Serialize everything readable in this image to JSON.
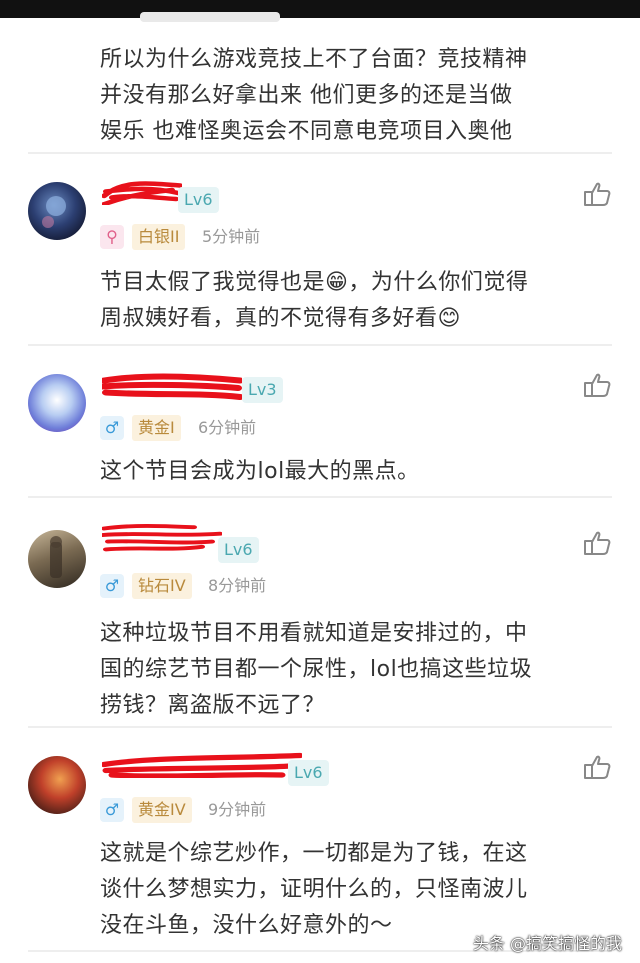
{
  "comments": [
    {
      "text_lines": [
        "所以为什么游戏竞技上不了台面？竞技精神",
        "并没有那么好拿出来 他们更多的还是当做",
        "娱乐 也难怪奥运会不同意电竞项目入奥他"
      ]
    },
    {
      "level": "Lv6",
      "gender_icon": "magnifier-icon",
      "gender_glyph": "⚲",
      "rank": "白银II",
      "time": "5分钟前",
      "text_lines": [
        "节目太假了我觉得也是😁，为什么你们觉得",
        "周叔姨好看，真的不觉得有多好看😊"
      ]
    },
    {
      "level": "Lv3",
      "gender_icon": "male-icon",
      "gender_glyph": "♂",
      "rank": "黄金I",
      "time": "6分钟前",
      "text_lines": [
        "这个节目会成为lol最大的黑点。"
      ]
    },
    {
      "level": "Lv6",
      "gender_icon": "male-icon",
      "gender_glyph": "♂",
      "rank": "钻石IV",
      "time": "8分钟前",
      "text_lines": [
        "这种垃圾节目不用看就知道是安排过的，中",
        "国的综艺节目都一个尿性，lol也搞这些垃圾",
        "捞钱？离盗版不远了？"
      ]
    },
    {
      "level": "Lv6",
      "gender_icon": "male-icon",
      "gender_glyph": "♂",
      "rank": "黄金IV",
      "time": "9分钟前",
      "text_lines": [
        "这就是个综艺炒作，一切都是为了钱，在这",
        "谈什么梦想实力，证明什么的，只怪南波儿",
        "没在斗鱼，没什么好意外的～"
      ]
    }
  ],
  "watermark": "头条 @搞笑搞怪的我",
  "colors": {
    "redaction": "#e8111b",
    "level_text": "#4aa8b0",
    "rank_text": "#b98a3c",
    "time_text": "#999999"
  }
}
